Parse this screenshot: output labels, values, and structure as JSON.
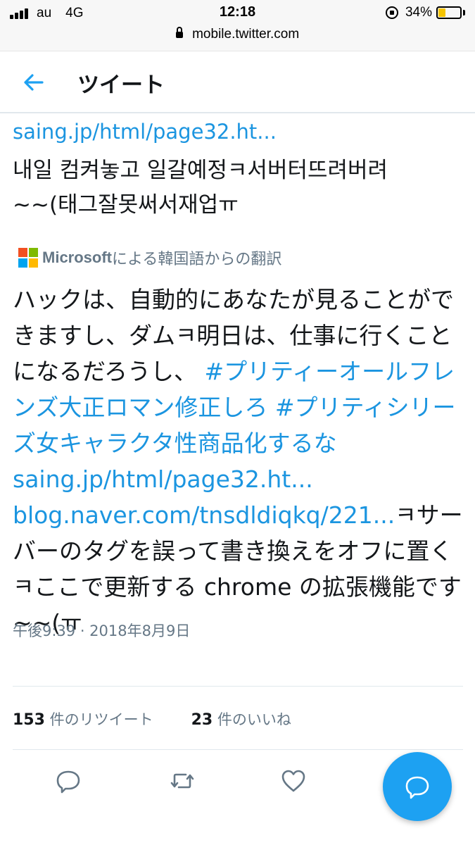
{
  "status_bar": {
    "carrier": "au",
    "network": "4G",
    "time": "12:18",
    "battery_percent_label": "34%",
    "battery_level": 0.34,
    "battery_color": "#f5c400"
  },
  "browser": {
    "url": "mobile.twitter.com"
  },
  "header": {
    "back_icon": "arrow-left-icon",
    "title": "ツイート"
  },
  "tweet": {
    "original_link": "saing.jp/html/page32.ht...",
    "original_text_line1": "내일 컴켜놓고 일갈예정ㅋ서버터뜨려버려",
    "original_text_line2": "~~(태그잘못써서재업ㅠ",
    "translation_brand": "Microsoft",
    "translation_label": "による韓国語からの翻訳",
    "translation": {
      "part1": "ハックは、自動的にあなたが見ることができますし、ダムㅋ明日は、仕事に行くことになるだろうし、 ",
      "hashtag1": "#プリティーオールフレンズ大正ロマン修正しろ",
      "space1": " ",
      "hashtag2": "#プリティシリーズ女キャラクタ性商品化するな",
      "space2": " ",
      "link1": "saing.jp/html/page32.ht...",
      "space3": " ",
      "link2": "blog.naver.com/tnsdldiqkq/221...",
      "part2": "ㅋサーバーのタグを誤って書き換えをオフに置くㅋここで更新する chrome の拡張機能です~~(ㅠ"
    },
    "timestamp": "午後9:39 · 2018年8月9日",
    "retweets_count": "153",
    "retweets_label": " 件のリツイート",
    "likes_count": "23",
    "likes_label": " 件のいいね"
  },
  "actions": {
    "reply_icon": "reply-icon",
    "retweet_icon": "retweet-icon",
    "like_icon": "heart-icon",
    "compose_icon": "compose-icon"
  },
  "colors": {
    "link_blue": "#1b95e0",
    "fab_blue": "#1da1f2",
    "secondary_text": "#657786"
  }
}
